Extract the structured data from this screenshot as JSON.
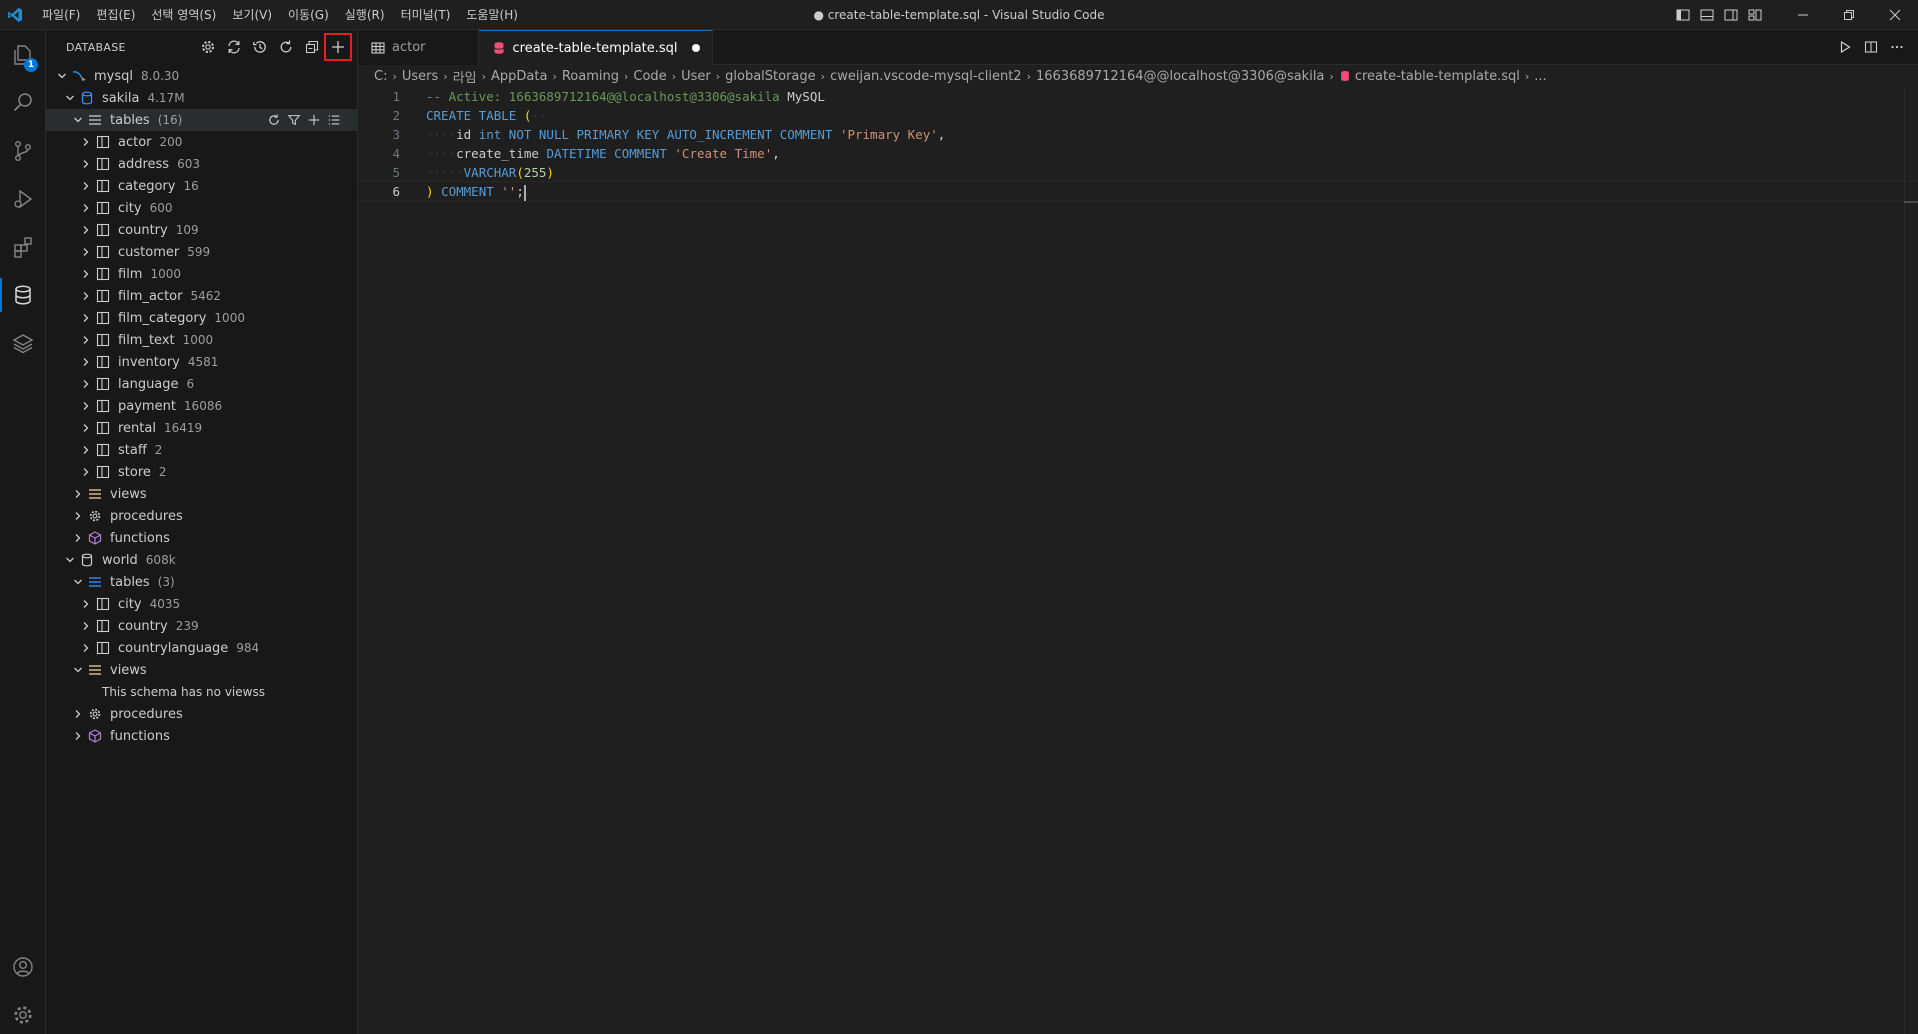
{
  "window": {
    "title": "● create-table-template.sql - Visual Studio Code",
    "menu": [
      "파일(F)",
      "편집(E)",
      "선택 영역(S)",
      "보기(V)",
      "이동(G)",
      "실행(R)",
      "터미널(T)",
      "도움말(H)"
    ]
  },
  "activity": {
    "explorer_badge": "1"
  },
  "sidebar": {
    "title": "DATABASE",
    "connection": {
      "label": "mysql",
      "desc": "8.0.30"
    },
    "sakila": {
      "label": "sakila",
      "desc": "4.17M",
      "tables_label": "tables",
      "tables_desc": "(16)",
      "tables": [
        {
          "name": "actor",
          "rows": "200"
        },
        {
          "name": "address",
          "rows": "603"
        },
        {
          "name": "category",
          "rows": "16"
        },
        {
          "name": "city",
          "rows": "600"
        },
        {
          "name": "country",
          "rows": "109"
        },
        {
          "name": "customer",
          "rows": "599"
        },
        {
          "name": "film",
          "rows": "1000"
        },
        {
          "name": "film_actor",
          "rows": "5462"
        },
        {
          "name": "film_category",
          "rows": "1000"
        },
        {
          "name": "film_text",
          "rows": "1000"
        },
        {
          "name": "inventory",
          "rows": "4581"
        },
        {
          "name": "language",
          "rows": "6"
        },
        {
          "name": "payment",
          "rows": "16086"
        },
        {
          "name": "rental",
          "rows": "16419"
        },
        {
          "name": "staff",
          "rows": "2"
        },
        {
          "name": "store",
          "rows": "2"
        }
      ],
      "views": "views",
      "procedures": "procedures",
      "functions": "functions"
    },
    "world": {
      "label": "world",
      "desc": "608k",
      "tables_label": "tables",
      "tables_desc": "(3)",
      "tables": [
        {
          "name": "city",
          "rows": "4035"
        },
        {
          "name": "country",
          "rows": "239"
        },
        {
          "name": "countrylanguage",
          "rows": "984"
        }
      ],
      "views": "views",
      "empty_views": "This schema has no viewss",
      "procedures": "procedures",
      "functions": "functions"
    }
  },
  "tabs": [
    {
      "label": "actor"
    },
    {
      "label": "create-table-template.sql"
    }
  ],
  "breadcrumb": [
    "C:",
    "Users",
    "라임",
    "AppData",
    "Roaming",
    "Code",
    "User",
    "globalStorage",
    "cweijan.vscode-mysql-client2",
    "1663689712164@@localhost@3306@sakila",
    "create-table-template.sql",
    "..."
  ],
  "code": {
    "line_numbers": [
      "1",
      "2",
      "3",
      "4",
      "5",
      "6"
    ],
    "l1_comment": "-- Active: 1663689712164@@localhost@3306@sakila",
    "l1_db": " MySQL",
    "l2_kw": "CREATE TABLE",
    "l2_paren": "(",
    "l3_name": "id",
    "l3_kw": "int NOT NULL PRIMARY KEY AUTO_INCREMENT COMMENT",
    "l3_str": "'Primary Key'",
    "l3_end": ",",
    "l4_name": "create_time",
    "l4_kw": "DATETIME COMMENT",
    "l4_str": "'Create Time'",
    "l4_end": ",",
    "l5_kw": "VARCHAR",
    "l5_open": "(",
    "l5_num": "255",
    "l5_close": ")",
    "l6_paren": ")",
    "l6_kw": "COMMENT",
    "l6_str": "''",
    "l6_end": ";"
  },
  "colors": {
    "accent": "#0078d4",
    "highlight_box": "#e51f1f",
    "db_icon": "#3794ff",
    "procedure_icon": "#cccccc",
    "function_icon": "#b180d7",
    "views_icon": "#e2c08d",
    "sql_file_icon": "#f14c7a"
  }
}
